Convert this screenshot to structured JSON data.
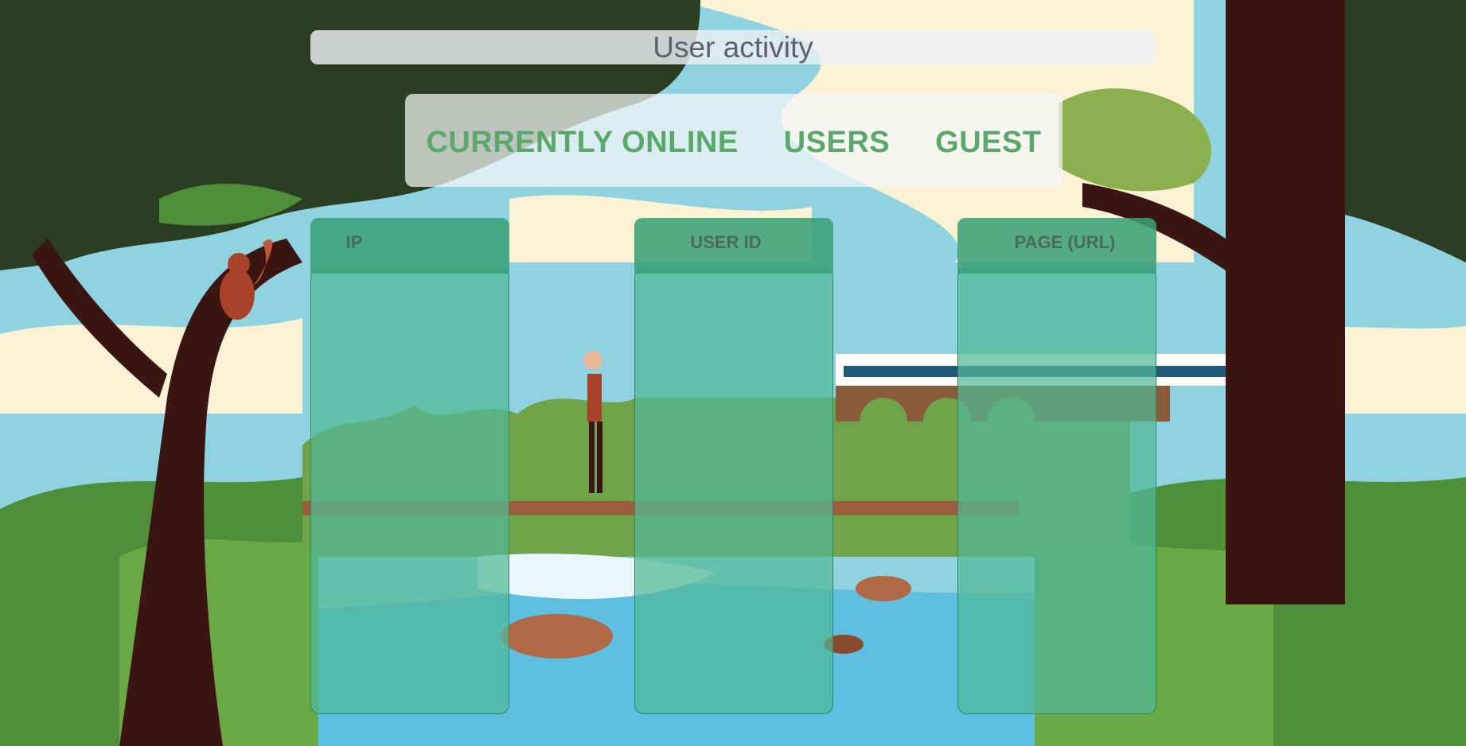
{
  "page": {
    "title": "User activity"
  },
  "tabs": [
    {
      "label": "CURRENTLY ONLINE"
    },
    {
      "label": "USERS"
    },
    {
      "label": "GUEST"
    }
  ],
  "table": {
    "columns": [
      {
        "header": "IP"
      },
      {
        "header": "USER ID"
      },
      {
        "header": "PAGE (URL)"
      }
    ],
    "rows": []
  },
  "colors": {
    "tab_text": "#5aa86a",
    "column_header_bg": "#3aa078",
    "column_body_bg": "#52b996",
    "title_text": "#5d6268"
  }
}
